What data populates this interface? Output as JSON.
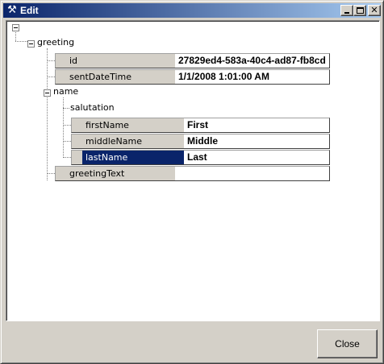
{
  "window": {
    "title": "Edit",
    "icon": "tools-icon"
  },
  "tree": {
    "greeting": {
      "label": "greeting",
      "id": {
        "name": "id",
        "value": "27829ed4-583a-40c4-ad87-fb8cd"
      },
      "sentDateTime": {
        "name": "sentDateTime",
        "value": "1/1/2008 1:01:00 AM"
      },
      "name": {
        "label": "name",
        "salutation": {
          "label": "salutation"
        },
        "firstName": {
          "name": "firstName",
          "value": "First"
        },
        "middleName": {
          "name": "middleName",
          "value": "Middle"
        },
        "lastName": {
          "name": "lastName",
          "value": "Last",
          "selected": true
        }
      },
      "greetingText": {
        "name": "greetingText",
        "value": ""
      }
    }
  },
  "footer": {
    "close_label": "Close"
  }
}
